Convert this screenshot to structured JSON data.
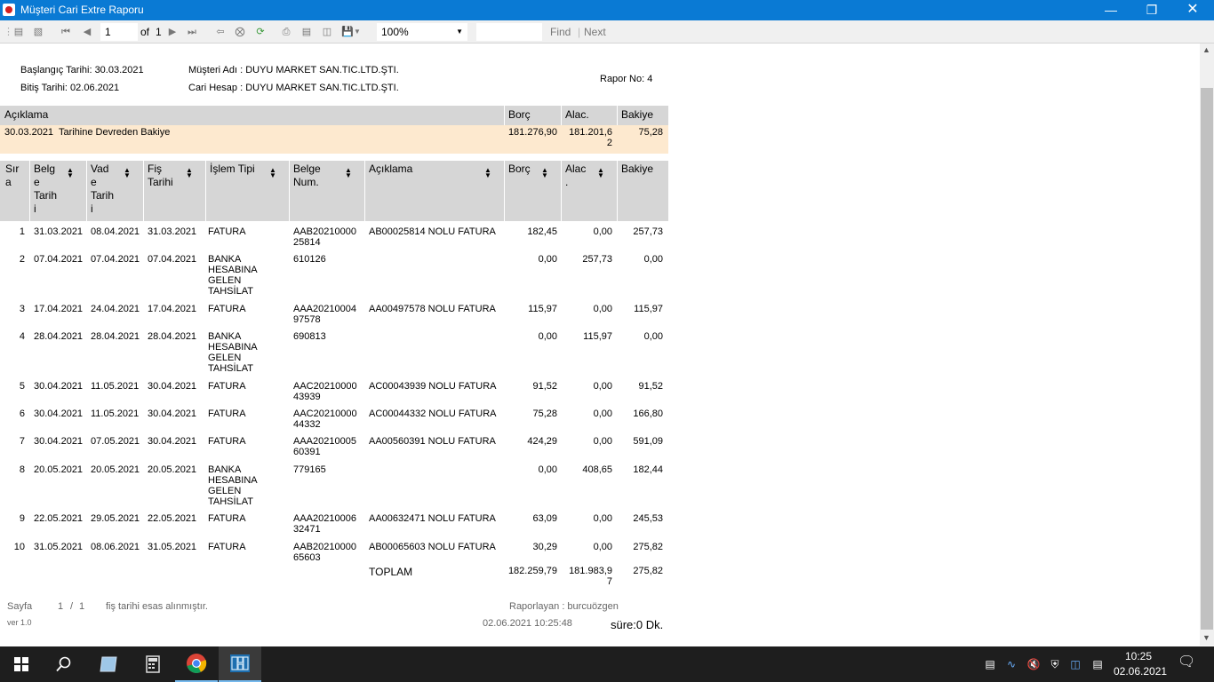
{
  "window": {
    "title": "Müşteri Cari Extre Raporu"
  },
  "toolbar": {
    "page": "1",
    "of_label": "of",
    "total_pages": "1",
    "zoom": "100%",
    "find": "Find",
    "next": "Next"
  },
  "report": {
    "start_date": "Başlangıç Tarihi: 30.03.2021",
    "end_date": "Bitiş Tarihi: 02.06.2021",
    "customer_name": "Müşteri Adı : DUYU MARKET SAN.TIC.LTD.ŞTI.",
    "account": "Cari Hesap : DUYU MARKET SAN.TIC.LTD.ŞTI.",
    "report_no": "Rapor No: 4",
    "summary_headers": [
      "Açıklama",
      "Borç",
      "Alac.",
      "Bakiye"
    ],
    "summary_row": {
      "desc": "30.03.2021  Tarihine Devreden Bakiye",
      "borc": "181.276,90",
      "alac": "181.201,6\n2",
      "bakiye": "75,28"
    },
    "columns": [
      "Sır\na",
      "Belg\ne\nTarih\ni",
      "Vad\ne\nTarih\ni",
      "Fiş\nTarihi",
      "İşlem Tipi",
      "Belge\nNum.",
      "Açıklama",
      "Borç",
      "Alac\n.",
      "Bakiye"
    ],
    "rows": [
      {
        "no": "1",
        "belge": "31.03.2021",
        "vade": "08.04.2021",
        "fis": "31.03.2021",
        "tip": "FATURA",
        "num": "AAB20210000\n25814",
        "aciklama": "AB00025814 NOLU FATURA",
        "borc": "182,45",
        "alac": "0,00",
        "bakiye": "257,73"
      },
      {
        "no": "2",
        "belge": "07.04.2021",
        "vade": "07.04.2021",
        "fis": "07.04.2021",
        "tip": "BANKA\nHESABINA\nGELEN\nTAHSİLAT",
        "num": "610126",
        "aciklama": "",
        "borc": "0,00",
        "alac": "257,73",
        "bakiye": "0,00"
      },
      {
        "no": "3",
        "belge": "17.04.2021",
        "vade": "24.04.2021",
        "fis": "17.04.2021",
        "tip": "FATURA",
        "num": "AAA20210004\n97578",
        "aciklama": "AA00497578 NOLU FATURA",
        "borc": "115,97",
        "alac": "0,00",
        "bakiye": "115,97"
      },
      {
        "no": "4",
        "belge": "28.04.2021",
        "vade": "28.04.2021",
        "fis": "28.04.2021",
        "tip": "BANKA\nHESABINA\nGELEN\nTAHSİLAT",
        "num": "690813",
        "aciklama": "",
        "borc": "0,00",
        "alac": "115,97",
        "bakiye": "0,00"
      },
      {
        "no": "5",
        "belge": "30.04.2021",
        "vade": "11.05.2021",
        "fis": "30.04.2021",
        "tip": "FATURA",
        "num": "AAC20210000\n43939",
        "aciklama": "AC00043939 NOLU FATURA",
        "borc": "91,52",
        "alac": "0,00",
        "bakiye": "91,52"
      },
      {
        "no": "6",
        "belge": "30.04.2021",
        "vade": "11.05.2021",
        "fis": "30.04.2021",
        "tip": "FATURA",
        "num": "AAC20210000\n44332",
        "aciklama": "AC00044332 NOLU FATURA",
        "borc": "75,28",
        "alac": "0,00",
        "bakiye": "166,80"
      },
      {
        "no": "7",
        "belge": "30.04.2021",
        "vade": "07.05.2021",
        "fis": "30.04.2021",
        "tip": "FATURA",
        "num": "AAA20210005\n60391",
        "aciklama": "AA00560391 NOLU FATURA",
        "borc": "424,29",
        "alac": "0,00",
        "bakiye": "591,09"
      },
      {
        "no": "8",
        "belge": "20.05.2021",
        "vade": "20.05.2021",
        "fis": "20.05.2021",
        "tip": "BANKA\nHESABINA\nGELEN\nTAHSİLAT",
        "num": "779165",
        "aciklama": "",
        "borc": "0,00",
        "alac": "408,65",
        "bakiye": "182,44"
      },
      {
        "no": "9",
        "belge": "22.05.2021",
        "vade": "29.05.2021",
        "fis": "22.05.2021",
        "tip": "FATURA",
        "num": "AAA20210006\n32471",
        "aciklama": "AA00632471 NOLU FATURA",
        "borc": "63,09",
        "alac": "0,00",
        "bakiye": "245,53"
      },
      {
        "no": "10",
        "belge": "31.05.2021",
        "vade": "08.06.2021",
        "fis": "31.05.2021",
        "tip": "FATURA",
        "num": "AAB20210000\n65603",
        "aciklama": "AB00065603 NOLU FATURA",
        "borc": "30,29",
        "alac": "0,00",
        "bakiye": "275,82"
      }
    ],
    "total": {
      "label": "TOPLAM",
      "borc": "182.259,79",
      "alac": "181.983,9\n7",
      "bakiye": "275,82"
    },
    "footer": {
      "page_label": "Sayfa",
      "page": "1",
      "sep": "/",
      "pages": "1",
      "note": "fiş tarihi esas alınmıştır.",
      "reporter": "Raporlayan : burcuözgen",
      "version": "ver 1.0",
      "datetime": "02.06.2021 10:25:48",
      "duration": "süre:0 Dk."
    }
  },
  "taskbar": {
    "time": "10:25",
    "date": "02.06.2021"
  }
}
